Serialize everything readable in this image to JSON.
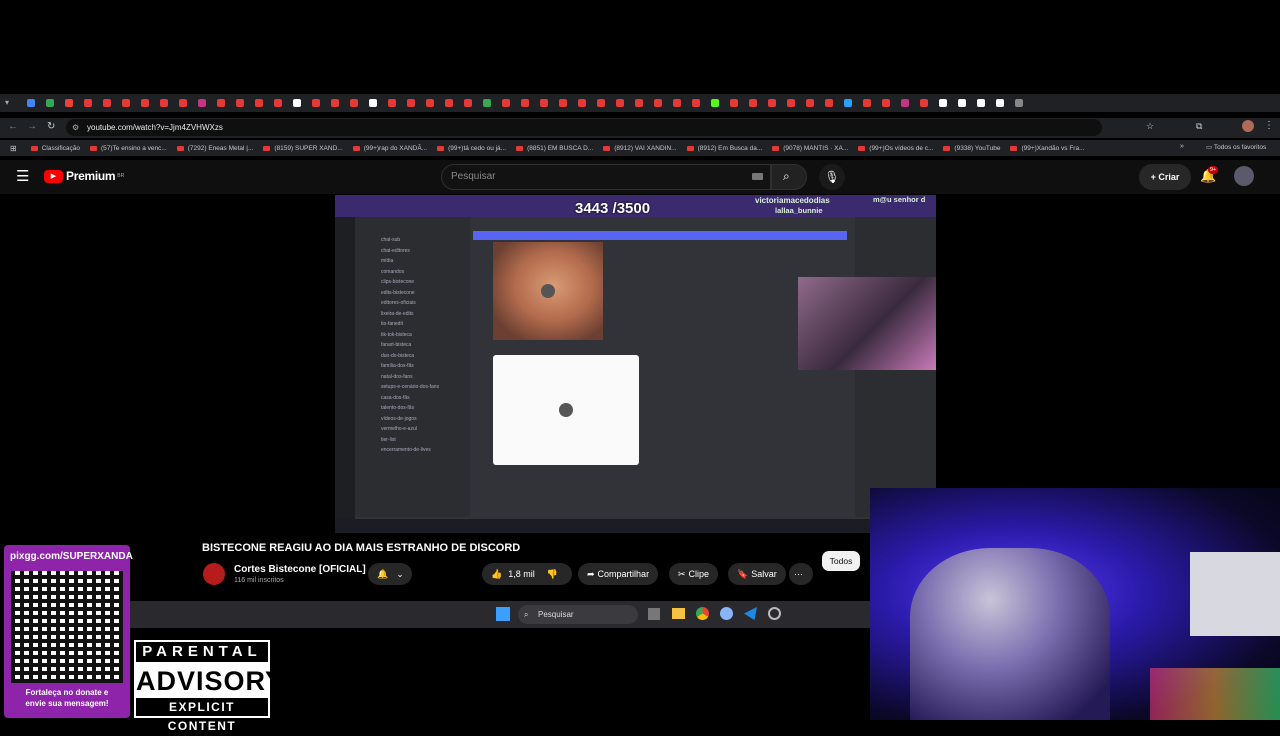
{
  "browser": {
    "url": "youtube.com/watch?v=Jjm4ZVHWXzs",
    "bookmarks": [
      "Classificação",
      "(57)Te ensino a venc...",
      "(7292) Eneas Metal |...",
      "(8159) SUPER XAND...",
      "(99+)rap do XANDÃ...",
      "(99+)tá cedo ou já...",
      "(8851) EM BUSCA D...",
      "(8912) VAI XANDIN...",
      "(8912) Em Busca da...",
      "(9078) MANTIS · XA...",
      "(99+)Os vídeos de c...",
      "(9338) YouTube",
      "(99+)Xandão vs Fra..."
    ],
    "all_bookmarks": "Todos os favoritos"
  },
  "youtube": {
    "logo": "Premium",
    "logo_suffix": "BR",
    "search_placeholder": "Pesquisar",
    "create_label": "Criar",
    "notifications_badge": "9+"
  },
  "video": {
    "counter": "3443 /3500",
    "viewer1": "victoriamacedodias",
    "viewer2": "lallaa_bunnie",
    "viewer3": "m@u senhor d",
    "channels": [
      "chat-sub",
      "chat-editores",
      "mídia",
      "comandos",
      "clips-bistecone",
      "edits-bistecone",
      "editores-oficiais",
      "lixeira-de-edits",
      "tio-fanedit",
      "tik-tok-bisteca",
      "fanart-bisteca",
      "duo-do-bisteca",
      "família-dos-fãs",
      "natal-dos-fans",
      "setups-e-cenário-dos-fans",
      "casa-dos-fãs",
      "talento-dos-fãs",
      "vídeos-de-jogos",
      "vermelho-e-azul",
      "tier-list",
      "encerramento-de-lives"
    ]
  },
  "meta": {
    "title": "BISTECONE REAGIU AO DIA MAIS ESTRANHO DE DISCORD",
    "channel": "Cortes Bistecone [OFICIAL]",
    "subscribers": "116 mil inscritos",
    "likes": "1,8 mil",
    "share": "Compartilhar",
    "clip": "Clipe",
    "save": "Salvar",
    "chip_all": "Todos"
  },
  "taskbar": {
    "search": "Pesquisar"
  },
  "overlay": {
    "qr_url": "pixgg.com/SUPERXANDA",
    "qr_caption_1": "Fortaleça no donate e",
    "qr_caption_2": "envie sua mensagem!",
    "advisory_top": "PARENTAL",
    "advisory_mid": "ADVISORY",
    "advisory_bot": "EXPLICIT CONTENT"
  }
}
